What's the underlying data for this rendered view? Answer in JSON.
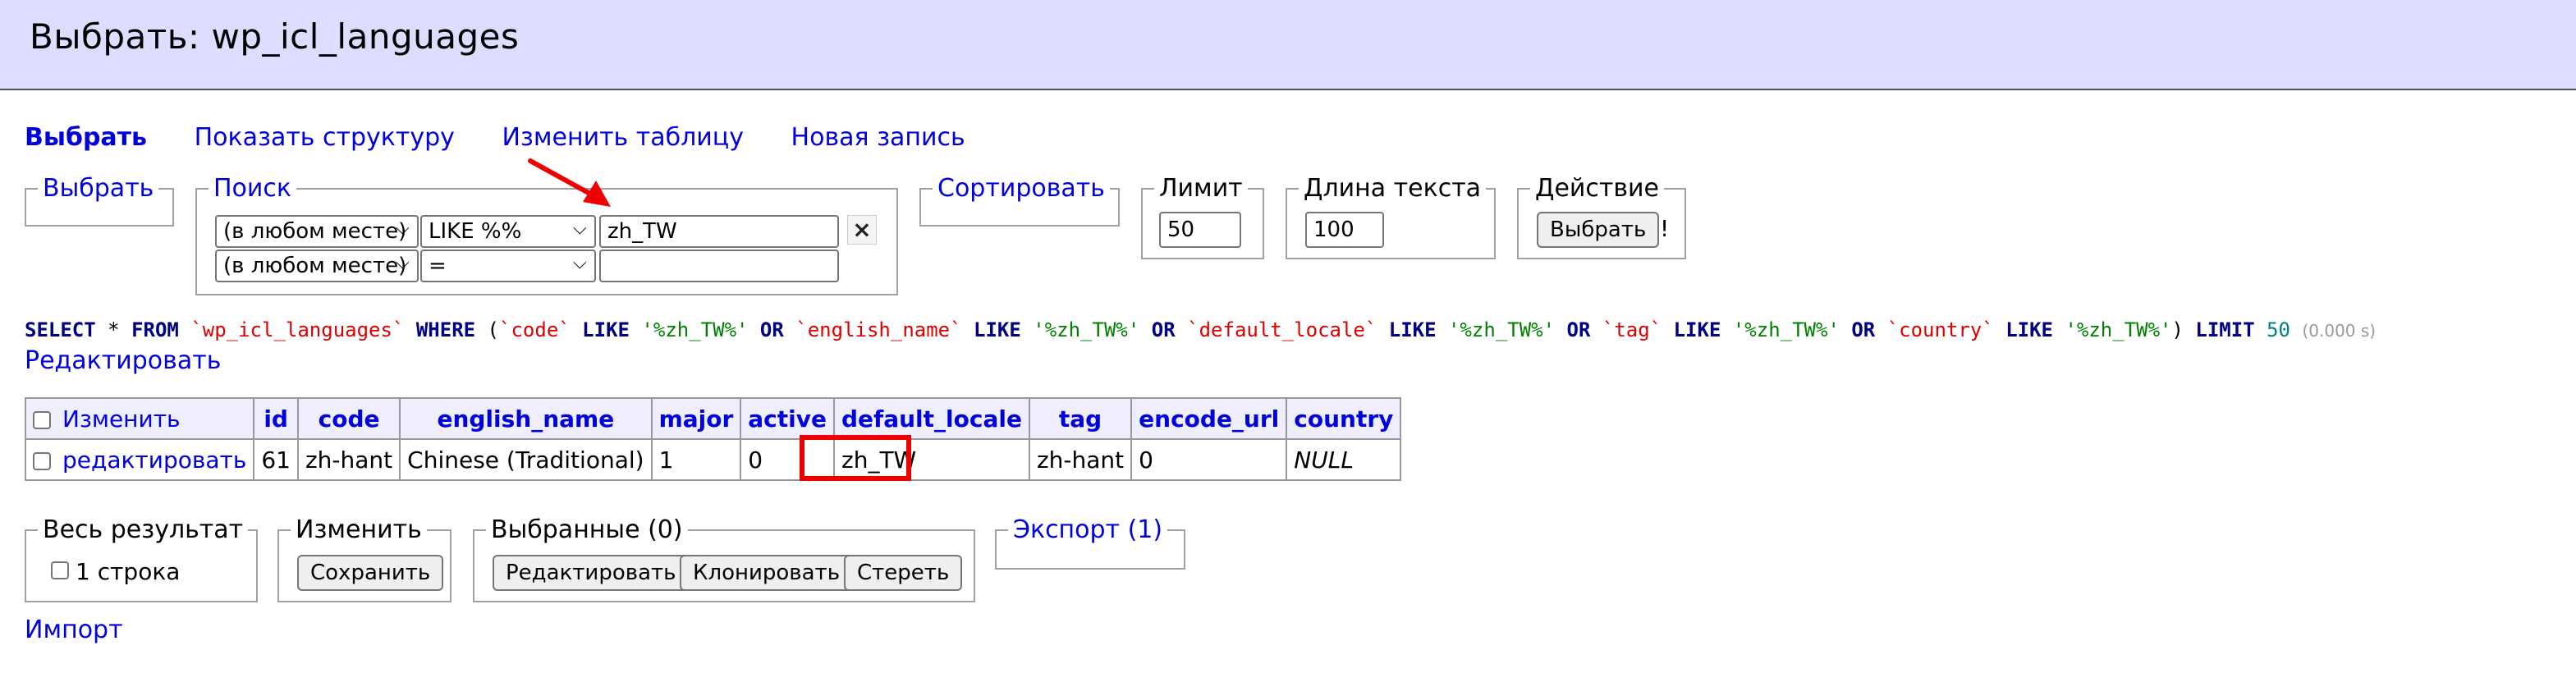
{
  "header": {
    "title": "Выбрать: wp_icl_languages"
  },
  "nav": {
    "select": "Выбрать",
    "structure": "Показать структуру",
    "alter": "Изменить таблицу",
    "new_item": "Новая запись"
  },
  "fieldsets": {
    "select_legend": "Выбрать",
    "search_legend": "Поиск",
    "sort_legend": "Сортировать",
    "limit_legend": "Лимит",
    "text_length_legend": "Длина текста",
    "action_legend": "Действие"
  },
  "search": {
    "row1": {
      "column": "(в любом месте)",
      "operator": "LIKE %%",
      "value": "zh_TW"
    },
    "row2": {
      "column": "(в любом месте)",
      "operator": "=",
      "value": ""
    },
    "remove_label": "×"
  },
  "limit": {
    "value": "50"
  },
  "text_length": {
    "value": "100"
  },
  "action": {
    "button": "Выбрать",
    "suffix": "!"
  },
  "query": {
    "time": "(0.000 s)",
    "edit_link": "Редактировать"
  },
  "table": {
    "headers": {
      "modify": "Изменить",
      "id": "id",
      "code": "code",
      "english_name": "english_name",
      "major": "major",
      "active": "active",
      "default_locale": "default_locale",
      "tag": "tag",
      "encode_url": "encode_url",
      "country": "country"
    },
    "rows": [
      {
        "edit": "редактировать",
        "id": "61",
        "code": "zh-hant",
        "english_name": "Chinese (Traditional)",
        "major": "1",
        "active": "0",
        "default_locale": "zh_TW",
        "tag": "zh-hant",
        "encode_url": "0",
        "country": "NULL"
      }
    ]
  },
  "bottom": {
    "whole_result_legend": "Весь результат",
    "rows_count": "1 строка",
    "modify_legend": "Изменить",
    "save_button": "Сохранить",
    "selected_legend": "Выбранные (0)",
    "edit_button": "Редактировать",
    "clone_button": "Клонировать",
    "delete_button": "Стереть",
    "export_legend": "Экспорт (1)",
    "import_link": "Импорт"
  },
  "colors": {
    "header_bg": "#ddddff",
    "link": "#0000dd",
    "highlight": "#ee0000"
  }
}
